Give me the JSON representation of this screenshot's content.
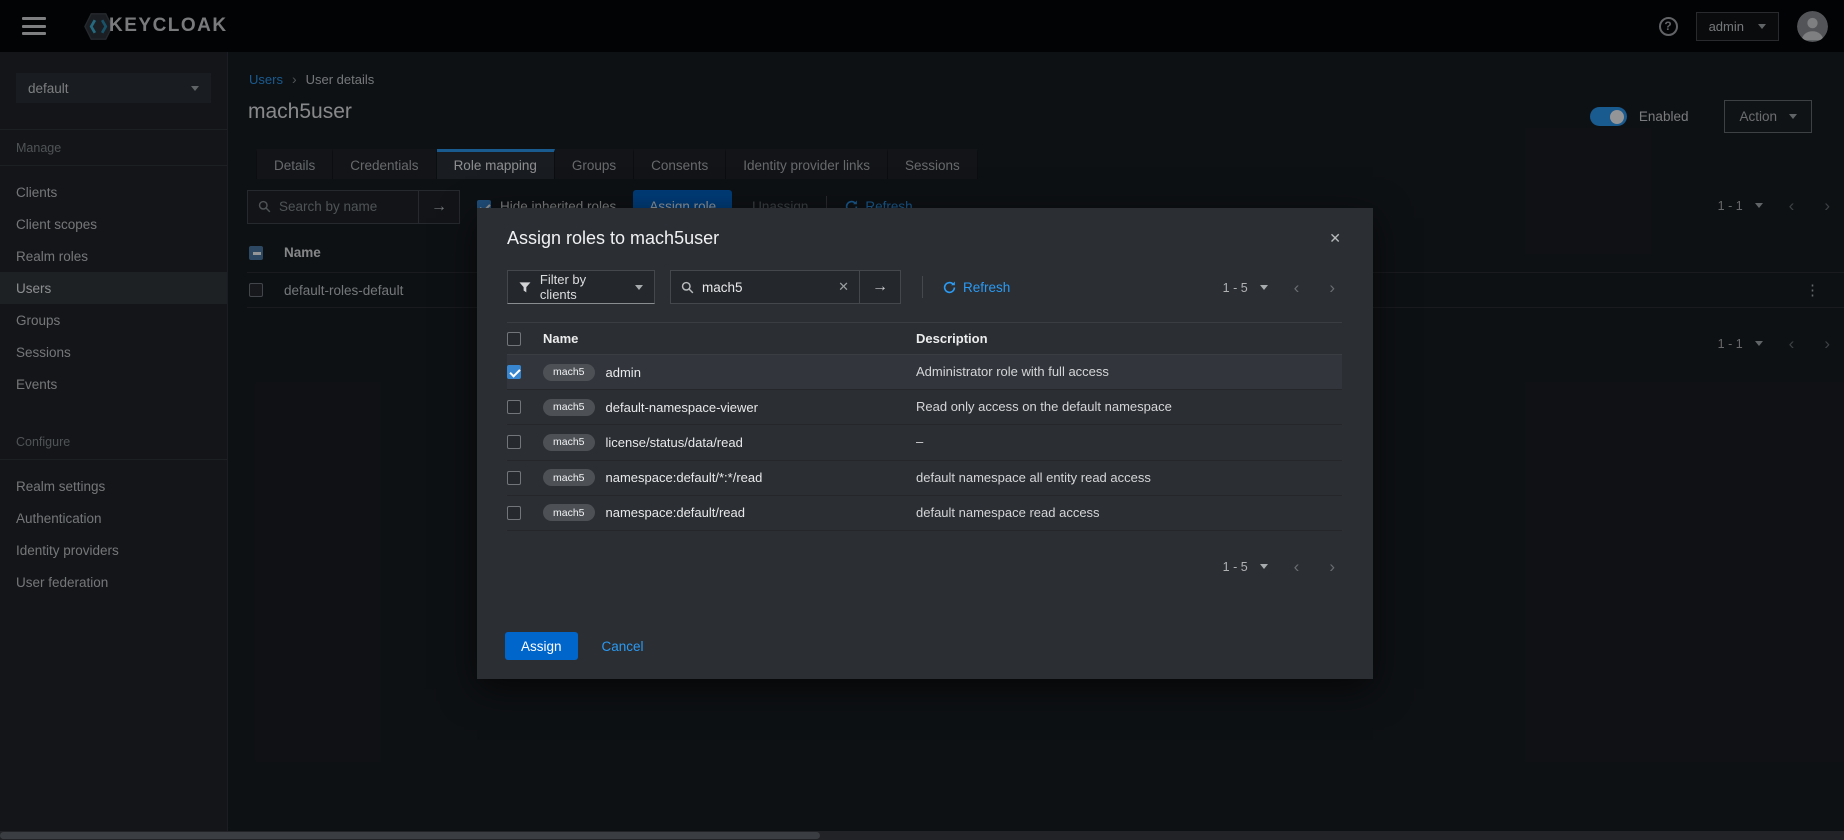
{
  "masthead": {
    "brand": "KEYCLOAK",
    "user_menu_label": "admin"
  },
  "sidebar": {
    "realm_select": "default",
    "sections": [
      {
        "label": "Manage",
        "items": [
          {
            "label": "Clients"
          },
          {
            "label": "Client scopes"
          },
          {
            "label": "Realm roles"
          },
          {
            "label": "Users"
          },
          {
            "label": "Groups"
          },
          {
            "label": "Sessions"
          },
          {
            "label": "Events"
          }
        ]
      },
      {
        "label": "Configure",
        "items": [
          {
            "label": "Realm settings"
          },
          {
            "label": "Authentication"
          },
          {
            "label": "Identity providers"
          },
          {
            "label": "User federation"
          }
        ]
      }
    ]
  },
  "breadcrumb": {
    "parent": "Users",
    "current": "User details"
  },
  "page": {
    "title": "mach5user",
    "enabled_label": "Enabled",
    "action_label": "Action",
    "tabs": [
      {
        "label": "Details"
      },
      {
        "label": "Credentials"
      },
      {
        "label": "Role mapping"
      },
      {
        "label": "Groups"
      },
      {
        "label": "Consents"
      },
      {
        "label": "Identity provider links"
      },
      {
        "label": "Sessions"
      }
    ],
    "active_tab": "Role mapping"
  },
  "role_mapping": {
    "search_placeholder": "Search by name",
    "hide_inherited_label": "Hide inherited roles",
    "assign_button": "Assign role",
    "unassign_button": "Unassign",
    "refresh_label": "Refresh",
    "pagination": "1 - 1",
    "name_header": "Name",
    "rows": [
      {
        "name": "default-roles-default"
      }
    ]
  },
  "modal": {
    "title": "Assign roles to mach5user",
    "filter_label": "Filter by clients",
    "search_value": "mach5",
    "refresh_label": "Refresh",
    "pagination": "1 - 5",
    "columns": {
      "name": "Name",
      "description": "Description"
    },
    "rows": [
      {
        "badge": "mach5",
        "name": "admin",
        "description": "Administrator role with full access",
        "checked": true
      },
      {
        "badge": "mach5",
        "name": "default-namespace-viewer",
        "description": "Read only access on the default namespace",
        "checked": false
      },
      {
        "badge": "mach5",
        "name": "license/status/data/read",
        "description": "–",
        "checked": false
      },
      {
        "badge": "mach5",
        "name": "namespace:default/*:*/read",
        "description": "default namespace all entity read access",
        "checked": false
      },
      {
        "badge": "mach5",
        "name": "namespace:default/read",
        "description": "default namespace read access",
        "checked": false
      }
    ],
    "assign_button": "Assign",
    "cancel_button": "Cancel"
  },
  "glyphs": {
    "arrow_right": "→",
    "close_x": "✕",
    "clear_x": "✕",
    "kebab": "⋮",
    "chevron_left": "‹",
    "chevron_right": "›",
    "breadcrumb_sep": "›",
    "help": "?"
  },
  "icons": {
    "hamburger-icon": "three-bars",
    "keycloak-logo-icon": "hexagon-code-brackets",
    "help-icon": "question-circle",
    "avatar-icon": "person-silhouette",
    "search-icon": "magnifier",
    "filter-icon": "funnel",
    "refresh-icon": "circular-arrow",
    "caret-down-icon": "triangle-down"
  },
  "colors": {
    "link_blue": "#2b9af3",
    "primary_button": "#0066cc",
    "toggle_on": "#2b9af3",
    "checkbox_checked": "#3786cf",
    "modal_background": "#2b2e33",
    "sidebar_background": "#212428",
    "masthead_background": "#050506",
    "badge_background": "#4d5156"
  }
}
